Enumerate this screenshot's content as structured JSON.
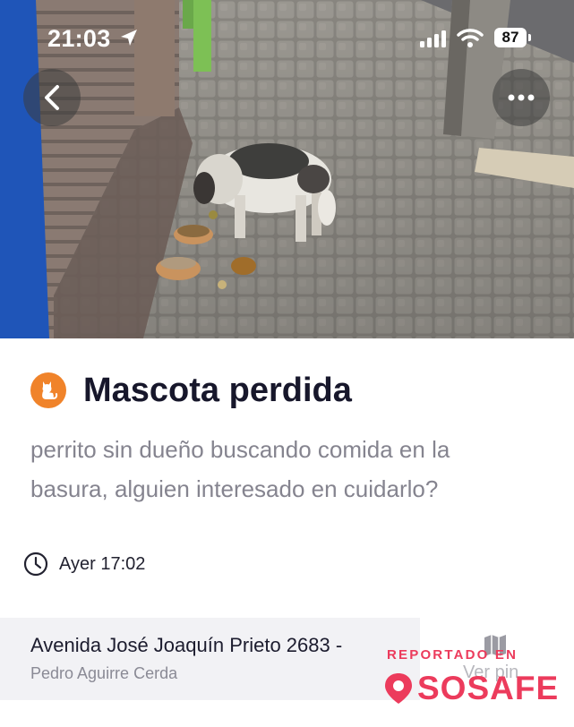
{
  "status_bar": {
    "time": "21:03",
    "battery": "87"
  },
  "nav": {
    "back_icon": "chevron-left-icon",
    "more_icon": "ellipsis-icon"
  },
  "report": {
    "category_icon": "cat-icon",
    "category_color": "#f0832a",
    "title": "Mascota perdida",
    "description": "perrito sin dueño buscando comida en la basura, alguien interesado en cuidarlo?",
    "time": "Ayer 17:02"
  },
  "address": {
    "street": "Avenida José Joaquín Prieto  2683 -",
    "commune": "Pedro Aguirre Cerda",
    "pin_label": "Ver pin"
  },
  "watermark": {
    "tagline": "REPORTADO EN",
    "brand": "SOSAFE",
    "color": "#ec3b5c"
  }
}
